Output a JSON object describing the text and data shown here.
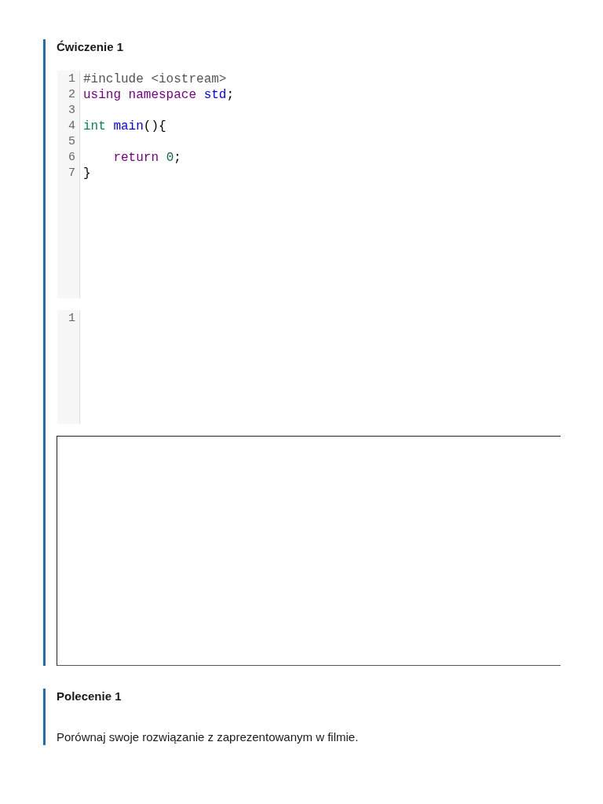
{
  "exercise": {
    "title": "Ćwiczenie 1",
    "code_editor": {
      "lines": [
        {
          "number": "1",
          "tokens": [
            {
              "text": "#include <iostream>",
              "kind": "meta"
            }
          ]
        },
        {
          "number": "2",
          "tokens": [
            {
              "text": "using ",
              "kind": "keyword"
            },
            {
              "text": "namespace ",
              "kind": "keyword"
            },
            {
              "text": "std",
              "kind": "def"
            },
            {
              "text": ";",
              "kind": "plain"
            }
          ]
        },
        {
          "number": "3"
        },
        {
          "number": "4",
          "tokens": [
            {
              "text": "int ",
              "kind": "type"
            },
            {
              "text": "main",
              "kind": "def"
            },
            {
              "text": "(){",
              "kind": "plain"
            }
          ]
        },
        {
          "number": "5"
        },
        {
          "number": "6",
          "tokens": [
            {
              "text": "    return ",
              "kind": "keyword"
            },
            {
              "text": "0",
              "kind": "number"
            },
            {
              "text": ";",
              "kind": "plain"
            }
          ]
        },
        {
          "number": "7",
          "tokens": [
            {
              "text": "}",
              "kind": "plain"
            }
          ]
        }
      ]
    },
    "input_editor": {
      "lines": [
        {
          "number": "1"
        }
      ]
    }
  },
  "task": {
    "title": "Polecenie 1",
    "text": "Porównaj swoje rozwiązanie z zaprezentowanym w filmie."
  }
}
